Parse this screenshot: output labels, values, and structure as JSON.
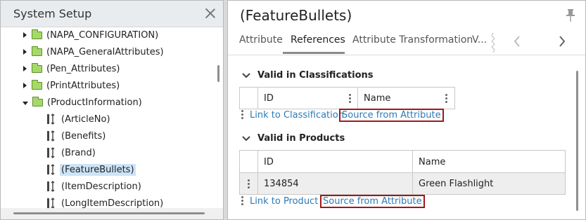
{
  "left_panel": {
    "title": "System Setup",
    "tree": [
      {
        "label": "(NAPA_CONFIGURATION)",
        "type": "folder",
        "expanded": false
      },
      {
        "label": "(NAPA_GeneralAttributes)",
        "type": "folder",
        "expanded": false
      },
      {
        "label": "(Pen_Attributes)",
        "type": "folder",
        "expanded": false
      },
      {
        "label": "(PrintAttributes)",
        "type": "folder",
        "expanded": false
      },
      {
        "label": "(ProductInformation)",
        "type": "folder",
        "expanded": true
      },
      {
        "label": "(ArticleNo)",
        "type": "attribute"
      },
      {
        "label": "(Benefits)",
        "type": "attribute"
      },
      {
        "label": "(Brand)",
        "type": "attribute"
      },
      {
        "label": "(FeatureBullets)",
        "type": "attribute",
        "selected": true
      },
      {
        "label": "(ItemDescription)",
        "type": "attribute"
      },
      {
        "label": "(LongItemDescription)",
        "type": "attribute"
      }
    ]
  },
  "right_panel": {
    "title": "(FeatureBullets)",
    "tabs": [
      {
        "label": "Attribute"
      },
      {
        "label": "References",
        "active": true
      },
      {
        "label": "Attribute Transformation"
      },
      {
        "label": "V..."
      }
    ],
    "sections": {
      "classifications": {
        "title": "Valid in Classifications",
        "columns": [
          "ID",
          "Name"
        ],
        "links": {
          "link_to": "Link to Classification",
          "source_from": "Source from Attribute"
        }
      },
      "products": {
        "title": "Valid in Products",
        "columns": [
          "ID",
          "Name"
        ],
        "rows": [
          {
            "id": "134854",
            "name": "Green Flashlight"
          }
        ],
        "links": {
          "link_to": "Link to Product",
          "source_from": "Source from Attribute"
        }
      }
    }
  },
  "colors": {
    "link": "#2a7ab8",
    "highlight_box": "#a01818",
    "folder_fill": "#a6d96a",
    "selection": "#cce4f7"
  }
}
